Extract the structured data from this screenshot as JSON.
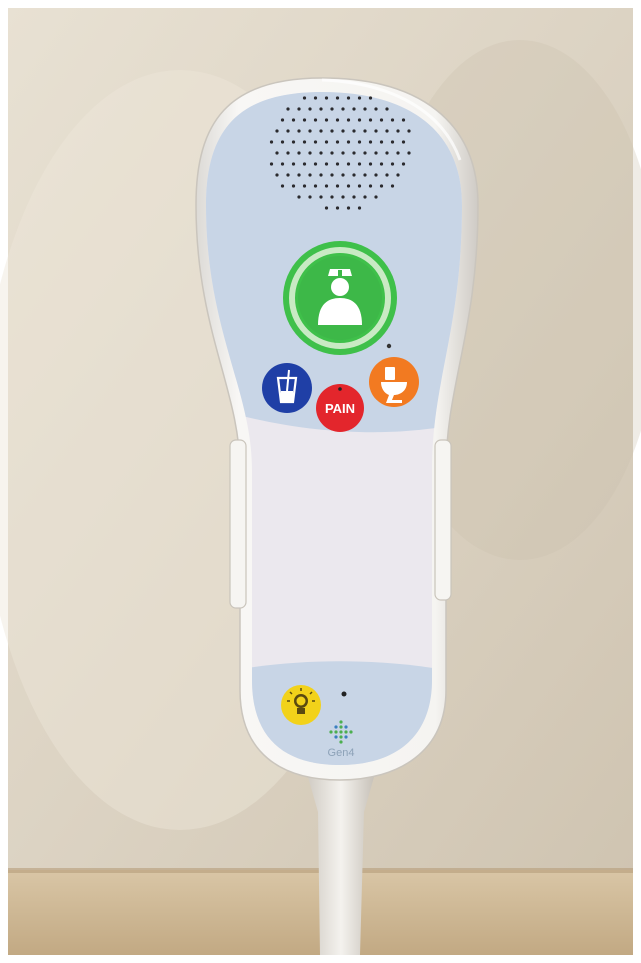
{
  "device": {
    "pain_button_label": "PAIN",
    "brand_logo_text": "Gen4",
    "buttons": [
      {
        "name": "nurse-call-button",
        "icon": "nurse-icon",
        "color": "#3bbf46"
      },
      {
        "name": "water-request-button",
        "icon": "water-glass-icon",
        "color": "#1f3fa6"
      },
      {
        "name": "pain-button",
        "icon": "pain-label",
        "color": "#e3262c"
      },
      {
        "name": "toilet-request-button",
        "icon": "toilet-icon",
        "color": "#f27a21"
      },
      {
        "name": "light-button",
        "icon": "lightbulb-icon",
        "color": "#f2d21a"
      }
    ]
  },
  "colors": {
    "wall": "#d9d0c0",
    "shelf": "#cbb696",
    "device_shell": "#f3f1ee",
    "panel_blue": "#c9d6e6",
    "panel_white": "#ece9ee"
  }
}
